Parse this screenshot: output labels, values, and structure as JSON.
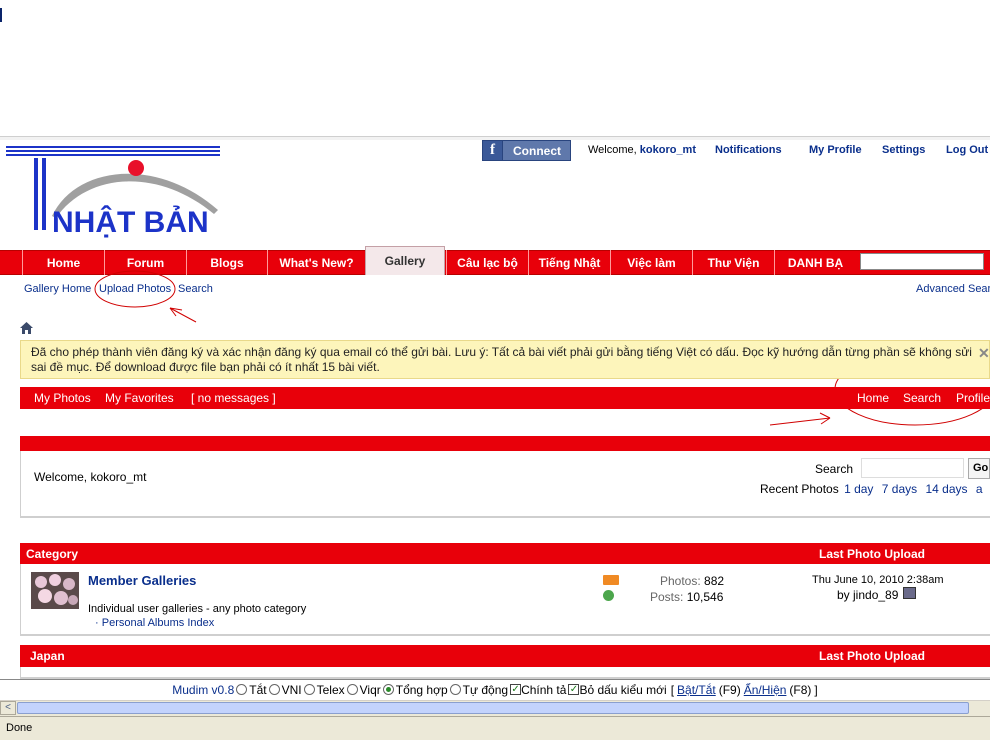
{
  "header": {
    "connect_label": "Connect",
    "facebook_glyph": "f",
    "welcome_prefix": "Welcome,",
    "username": "kokoro_mt",
    "links": [
      "Notifications",
      "My Profile",
      "Settings",
      "Log Out"
    ]
  },
  "logo": {
    "text": "NHẬT BẢN",
    "colors": {
      "blue": "#1c33c8",
      "red": "#e8102a",
      "gray": "#9a9a9a"
    }
  },
  "nav": {
    "tabs": [
      "Home",
      "Forum",
      "Blogs",
      "What's New?",
      "Gallery",
      "Câu lạc bộ",
      "Tiếng Nhật",
      "Việc làm",
      "Thư Viện",
      "DANH BẠ"
    ],
    "active": "Gallery"
  },
  "subnav": {
    "links": [
      "Gallery Home",
      "Upload Photos",
      "Search"
    ],
    "advanced": "Advanced Sear"
  },
  "notice": {
    "text": "Đã cho phép thành viên đăng ký và xác nhận đăng ký qua email có thể gửi bài. Lưu ý: Tất cả bài viết phải gửi bằng tiếng Việt có dấu. Đọc kỹ hướng dẫn từng phần sẽ không sửi sai đề mục. Để download được file bạn phải có ít nhất 15 bài viết.",
    "close": "✕"
  },
  "gallery_bar": {
    "left": [
      "My Photos",
      "My Favorites",
      "[ no messages ]"
    ],
    "right": [
      "Home",
      "Search",
      "Profile"
    ]
  },
  "welcome_box": {
    "welcome": "Welcome, kokoro_mt",
    "search_label": "Search",
    "go_label": "Go",
    "recent_label": "Recent Photos",
    "recent_links": [
      "1 day",
      "7 days",
      "14 days",
      "a"
    ]
  },
  "category_table": {
    "header_left": "Category",
    "header_right": "Last Photo Upload",
    "rows": [
      {
        "title": "Member Galleries",
        "description": "Individual user galleries - any photo category",
        "sub_link": "Personal Albums Index",
        "photos_label": "Photos:",
        "photos_value": "882",
        "posts_label": "Posts:",
        "posts_value": "10,546",
        "last_date": "Thu June 10, 2010 2:38am",
        "last_by": "by jindo_89"
      }
    ]
  },
  "japan_section": {
    "header_left": "Japan",
    "header_right": "Last Photo Upload"
  },
  "mudim": {
    "name": "Mudim v0.8",
    "options": [
      "Tắt",
      "VNI",
      "Telex",
      "Viqr",
      "Tổng hợp",
      "Tự động"
    ],
    "selected": "Tổng hợp",
    "checks": [
      "Chính tả",
      "Bỏ dấu kiểu mới"
    ],
    "toggle_prefix": "[",
    "toggle": "Bật/Tắt",
    "toggle_key": "(F9)",
    "showhide": "Ẩn/Hiện",
    "showhide_key": "(F8)",
    "toggle_suffix": "]"
  },
  "status": {
    "text": "Done"
  }
}
